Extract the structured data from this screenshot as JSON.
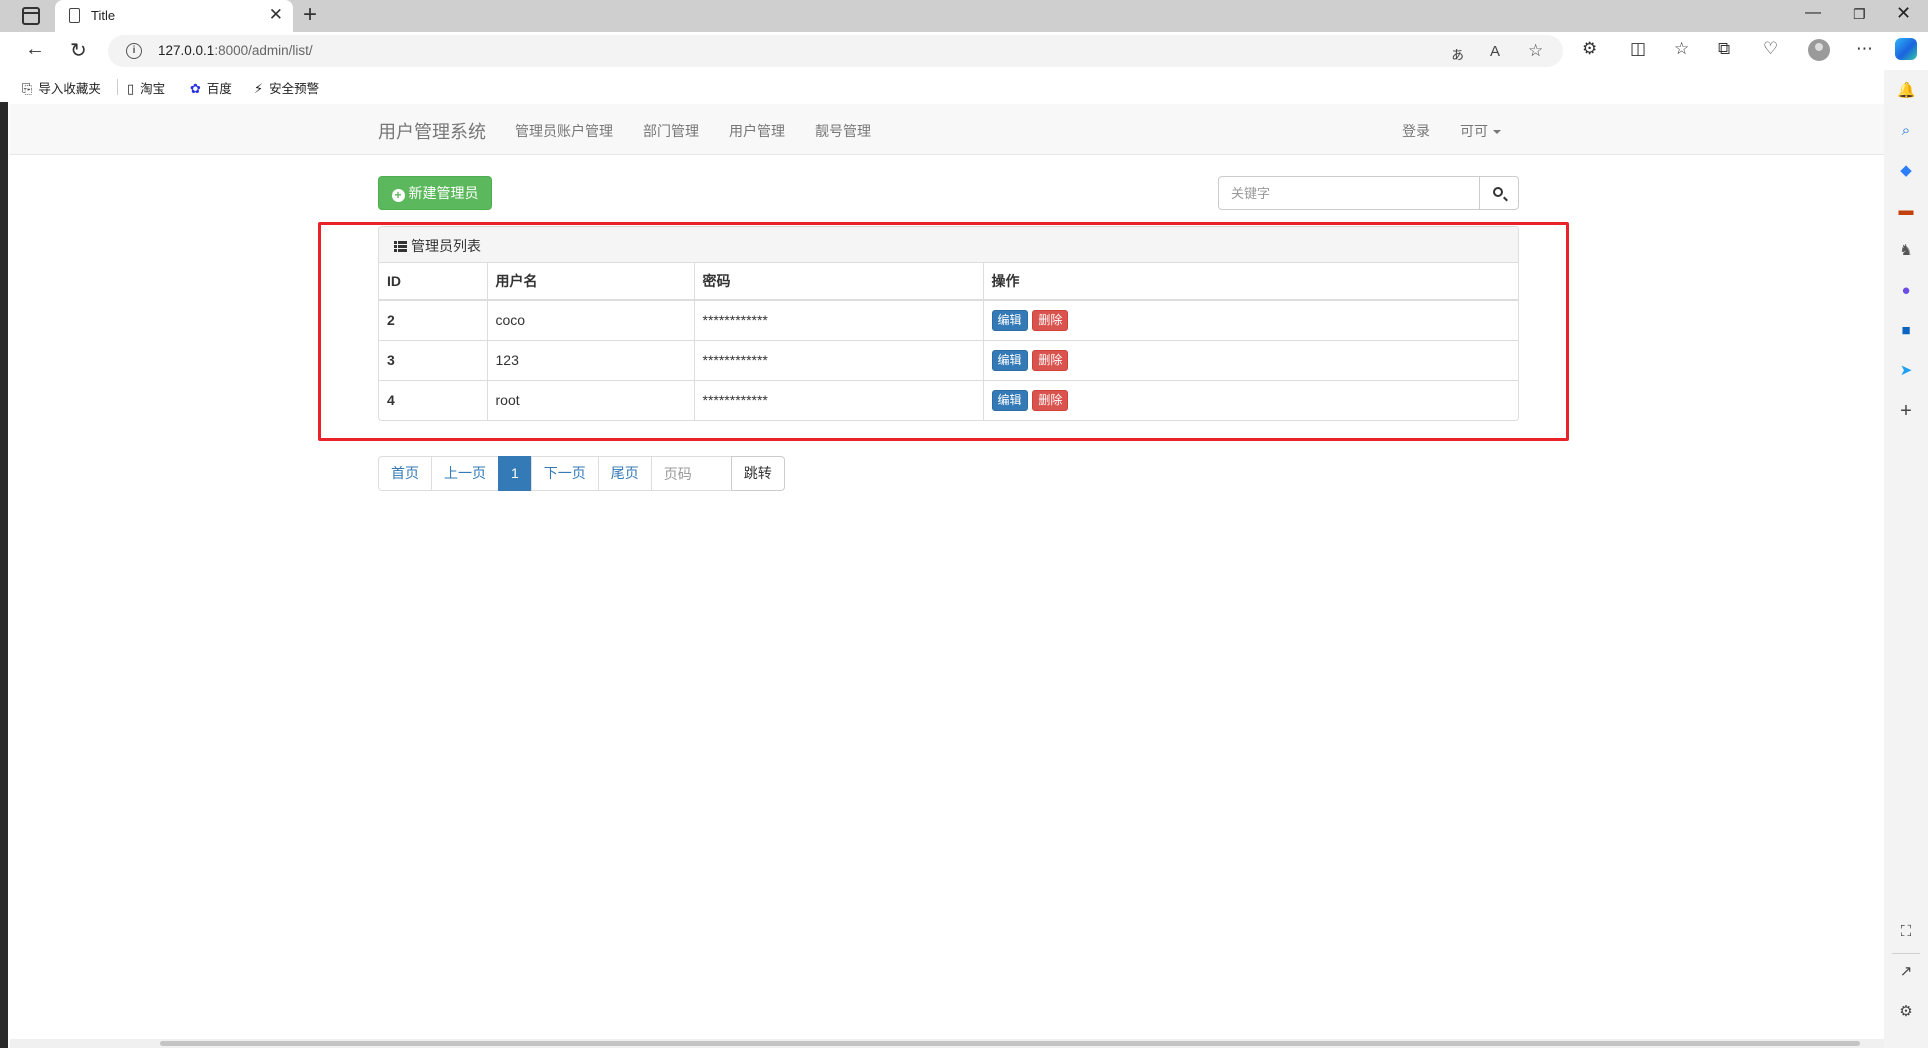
{
  "browser": {
    "tab_title": "Title",
    "url_host": "127.0.0.1",
    "url_rest": ":8000/admin/list/",
    "favorites": [
      {
        "label": "导入收藏夹",
        "icon": "import-favorites-icon"
      },
      {
        "label": "淘宝",
        "icon": "page-icon"
      },
      {
        "label": "百度",
        "icon": "baidu-paw-icon"
      },
      {
        "label": "安全预警",
        "icon": "security-alert-icon"
      }
    ]
  },
  "navbar": {
    "brand": "用户管理系统",
    "links": [
      "管理员账户管理",
      "部门管理",
      "用户管理",
      "靓号管理"
    ],
    "login": "登录",
    "user": "可可"
  },
  "toolbar": {
    "new_admin_label": "新建管理员",
    "search_placeholder": "关键字"
  },
  "panel": {
    "title": "管理员列表",
    "columns": [
      "ID",
      "用户名",
      "密码",
      "操作"
    ],
    "rows": [
      {
        "id": "2",
        "username": "coco",
        "password": "************"
      },
      {
        "id": "3",
        "username": "123",
        "password": "************"
      },
      {
        "id": "4",
        "username": "root",
        "password": "************"
      }
    ],
    "edit_label": "编辑",
    "delete_label": "删除"
  },
  "pagination": {
    "first": "首页",
    "prev": "上一页",
    "current": "1",
    "next": "下一页",
    "last": "尾页",
    "page_placeholder": "页码",
    "jump": "跳转"
  },
  "colors": {
    "success": "#5cb85c",
    "primary": "#337ab7",
    "danger": "#d9534f",
    "highlight": "#e8242a"
  }
}
